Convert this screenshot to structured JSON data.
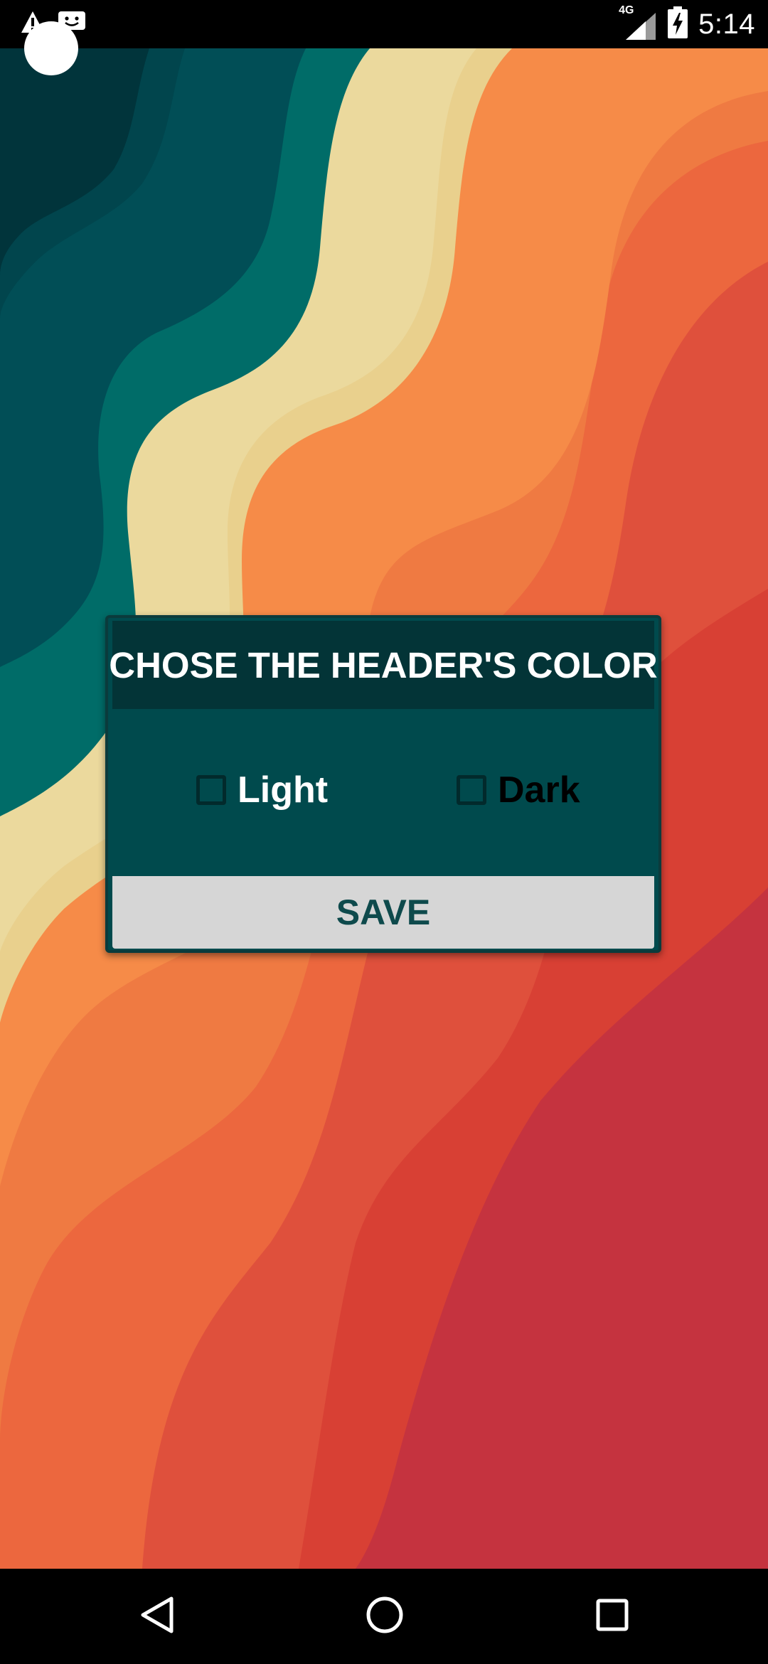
{
  "status_bar": {
    "time": "5:14",
    "network_label": "4G",
    "icons": [
      "alert-icon",
      "assistant-icon",
      "signal-icon",
      "battery-charging-icon"
    ]
  },
  "dialog": {
    "title": "CHOSE THE HEADER'S COLOR",
    "options": [
      {
        "label": "Light",
        "checked": false
      },
      {
        "label": "Dark",
        "checked": false
      }
    ],
    "save_label": "SAVE"
  },
  "navigation": {
    "icons": [
      "back-icon",
      "home-icon",
      "recents-icon"
    ]
  },
  "colors": {
    "dialog_background": "#004a4d",
    "dialog_header": "#033437",
    "save_button_background": "#d6d6d6",
    "save_button_text": "#0e4a4c"
  }
}
